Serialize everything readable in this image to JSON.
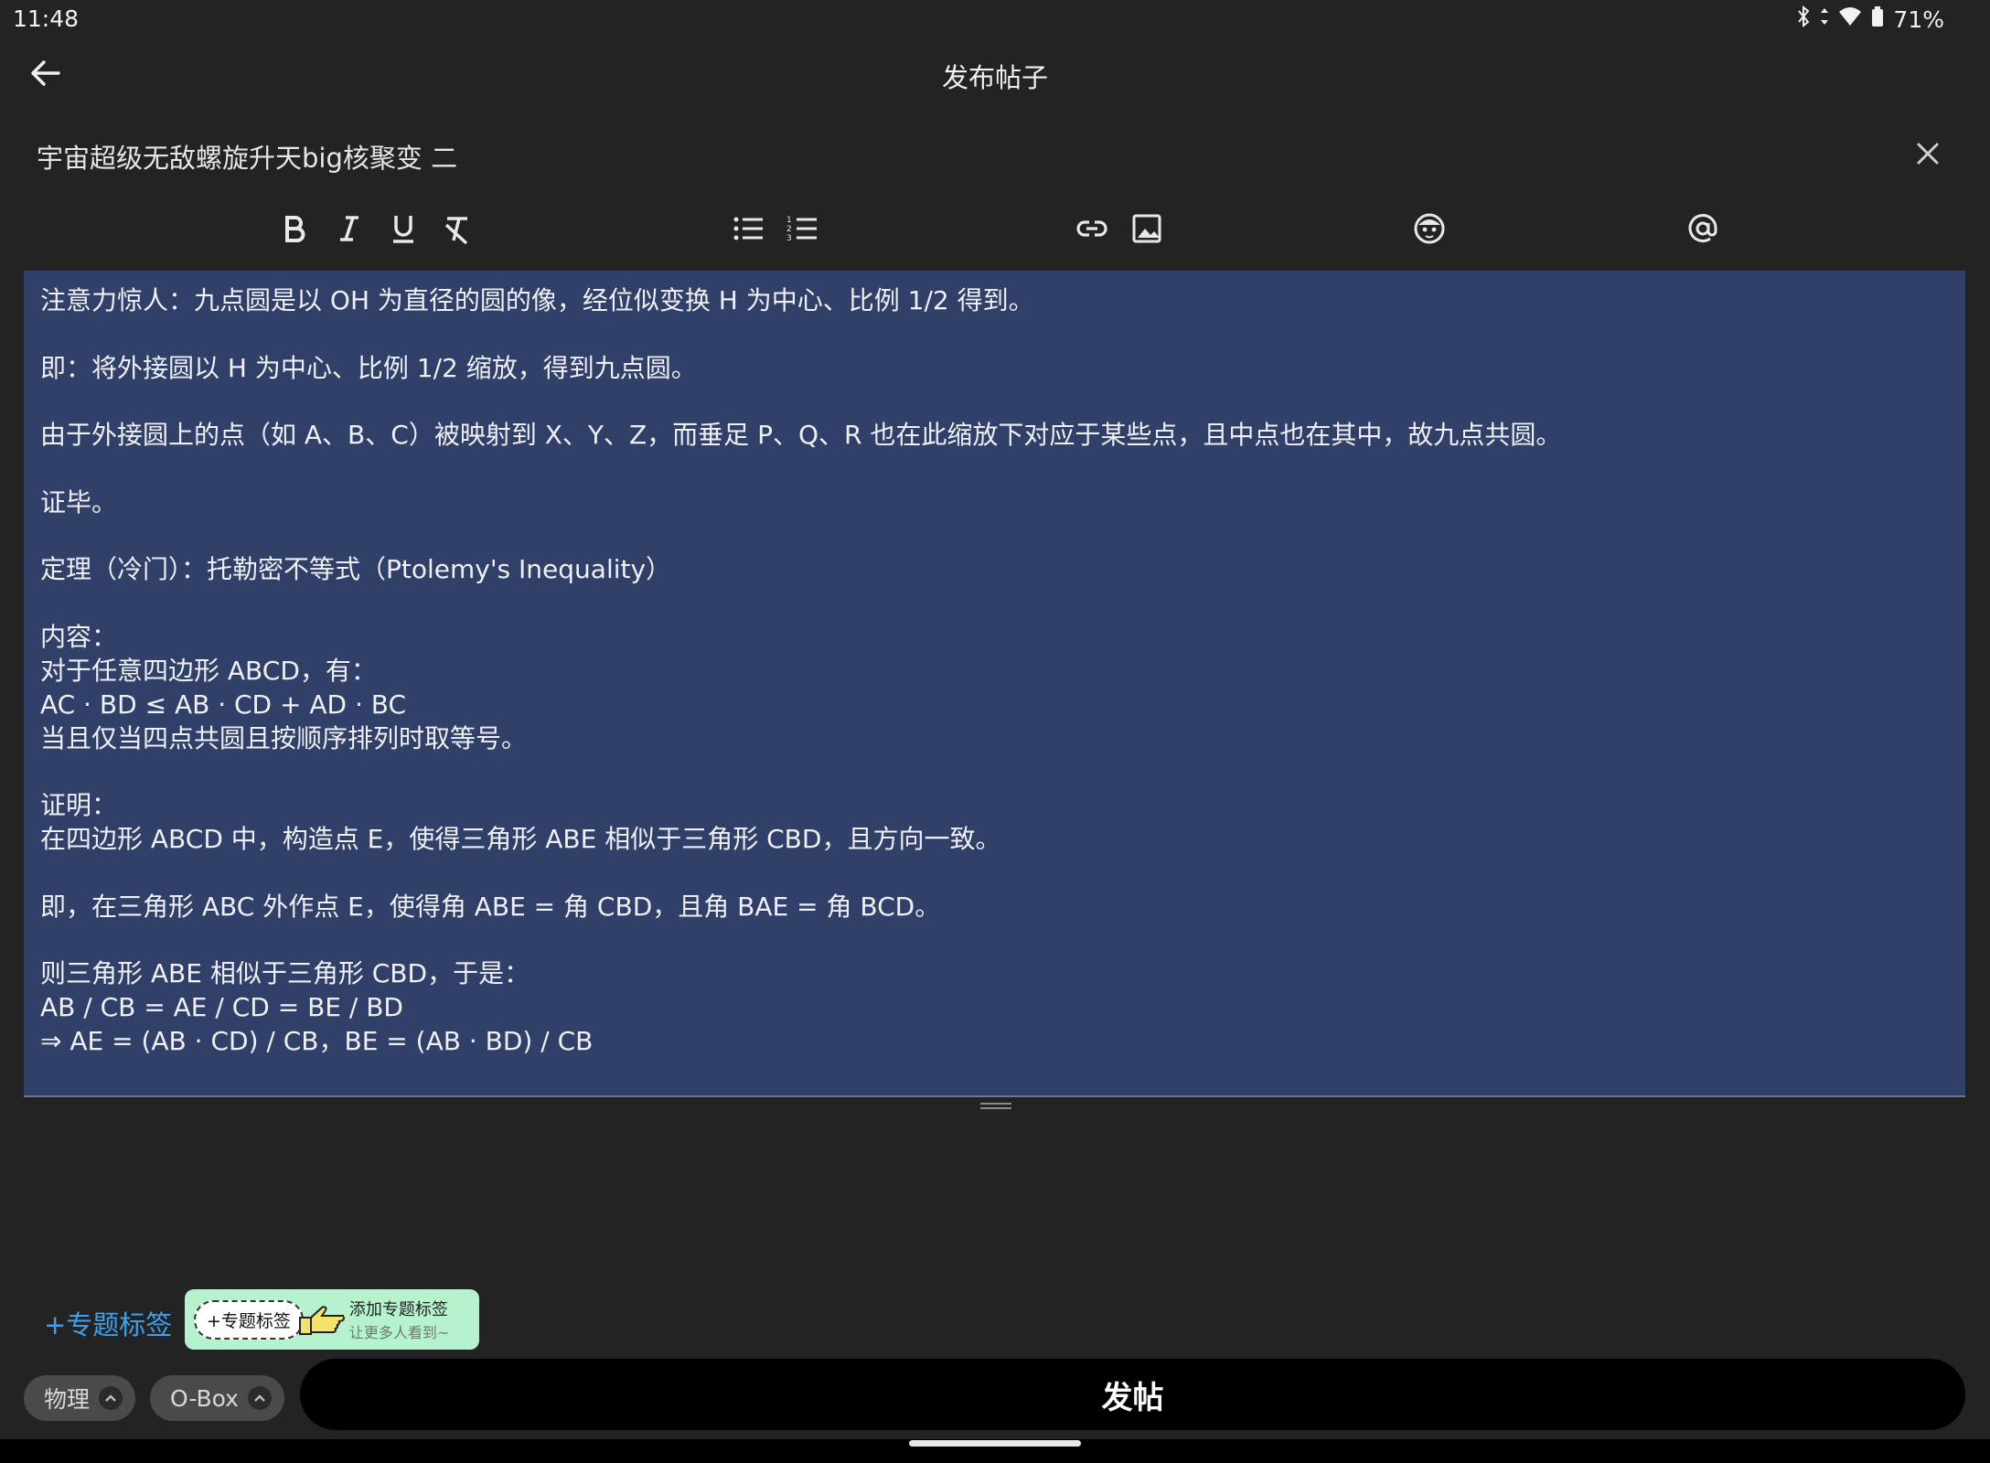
{
  "status_bar": {
    "time": "11:48",
    "battery": "71%",
    "icons": [
      "bluetooth-icon",
      "data-icon",
      "wifi-icon",
      "battery-icon"
    ]
  },
  "header": {
    "title": "发布帖子",
    "back_icon": "arrow-left-icon"
  },
  "post": {
    "title": "宇宙超级无敌螺旋升天big核聚变 二"
  },
  "toolbar": {
    "items": [
      "bold-icon",
      "italic-icon",
      "underline-icon",
      "clear-format-icon",
      "bullet-list-icon",
      "numbered-list-icon",
      "link-icon",
      "image-icon",
      "emoji-icon",
      "mention-icon"
    ]
  },
  "editor": {
    "lines": [
      "注意力惊人：九点圆是以 OH 为直径的圆的像，经位似变换 H 为中心、比例 1/2 得到。",
      "即：将外接圆以 H 为中心、比例 1/2 缩放，得到九点圆。",
      "由于外接圆上的点（如 A、B、C）被映射到 X、Y、Z，而垂足 P、Q、R 也在此缩放下对应于某些点，且中点也在其中，故九点共圆。",
      "证毕。",
      "定理（冷门）：托勒密不等式（Ptolemy's Inequality）",
      "内容：",
      "对于任意四边形 ABCD，有：",
      "AC · BD ≤ AB · CD + AD · BC",
      "当且仅当四点共圆且按顺序排列时取等号。",
      "证明：",
      "在四边形 ABCD 中，构造点 E，使得三角形 ABE 相似于三角形 CBD，且方向一致。",
      "即，在三角形 ABC 外作点 E，使得角 ABE = 角 CBD，且角 BAE = 角 BCD。",
      "则三角形 ABE 相似于三角形 CBD，于是：",
      "AB / CB = AE / CD = BE / BD",
      "⇒ AE = (AB · CD) / CB，BE = (AB · BD) / CB"
    ]
  },
  "topic": {
    "link_label": "+专题标签",
    "tip_chip": "+专题标签",
    "tip_title": "添加专题标签",
    "tip_sub": "让更多人看到~"
  },
  "tags": [
    {
      "label": "物理"
    },
    {
      "label": "O-Box"
    }
  ],
  "publish_label": "发帖",
  "colors": {
    "background": "#232323",
    "editor_bg": "#304069",
    "accent_link": "#3aa0ef",
    "tip_bg": "#b7f2cf",
    "publish_bg": "#000000"
  }
}
